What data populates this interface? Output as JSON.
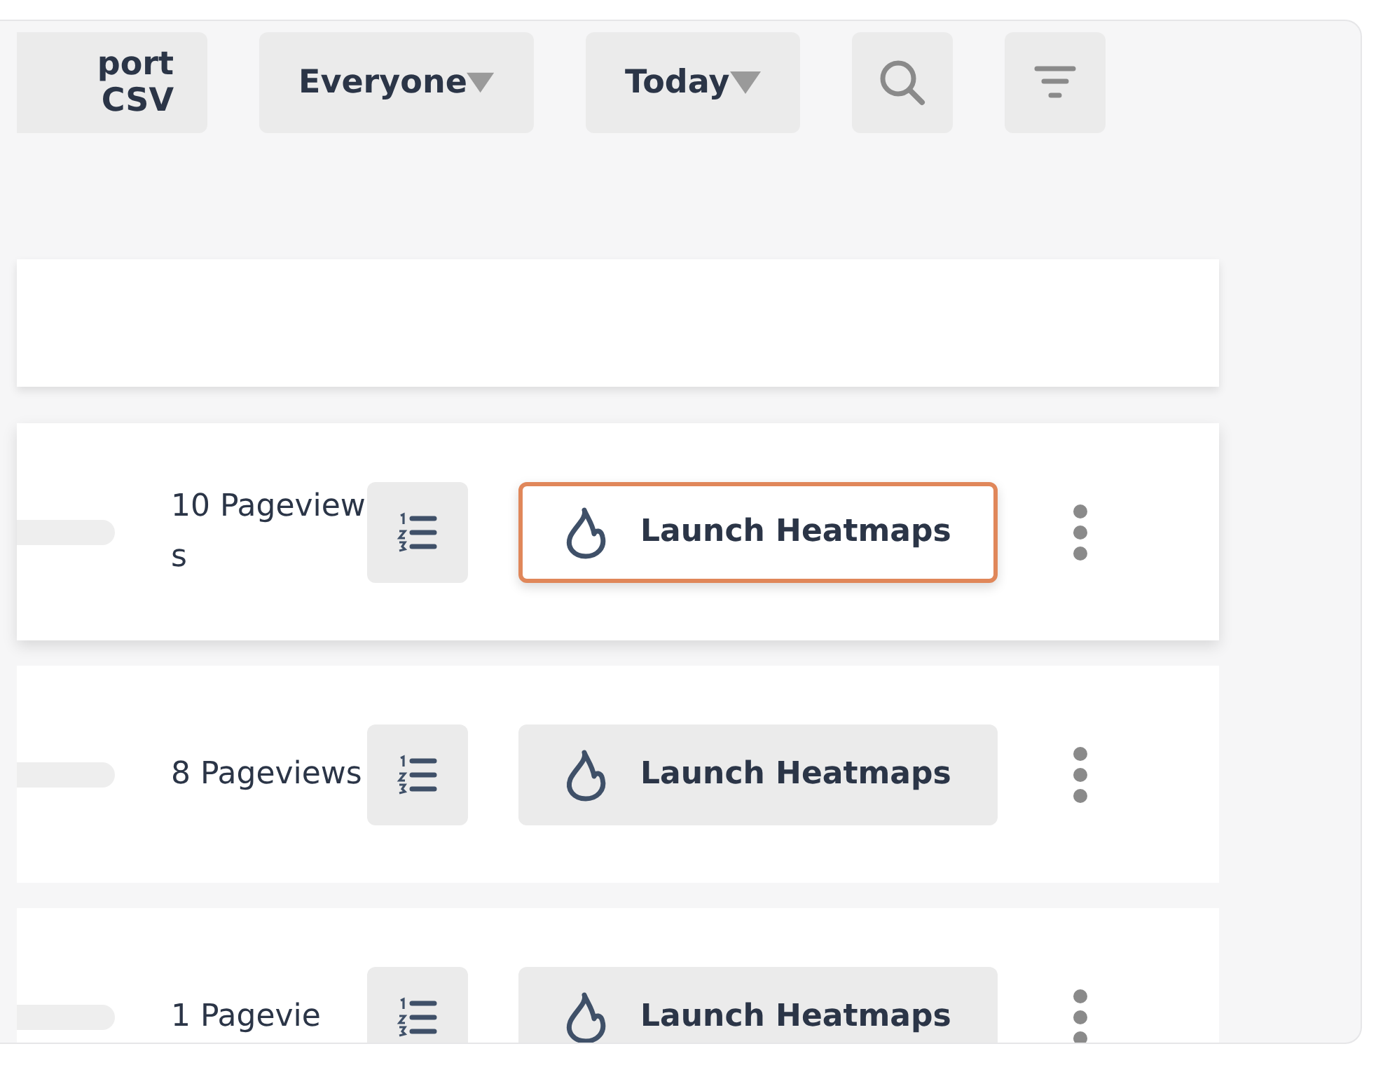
{
  "toolbar": {
    "export_button": "port CSV",
    "dropdowns": [
      {
        "label": "Everyone"
      },
      {
        "label": "Today"
      }
    ]
  },
  "rows": [
    {
      "pageviews": "10 Pageviews",
      "action": "Launch Heatmaps",
      "highlighted": true
    },
    {
      "pageviews": "8 Pageviews",
      "action": "Launch Heatmaps",
      "highlighted": false
    },
    {
      "pageviews": "1 Pagevie",
      "action": "Launch Heatmaps",
      "highlighted": false
    }
  ]
}
